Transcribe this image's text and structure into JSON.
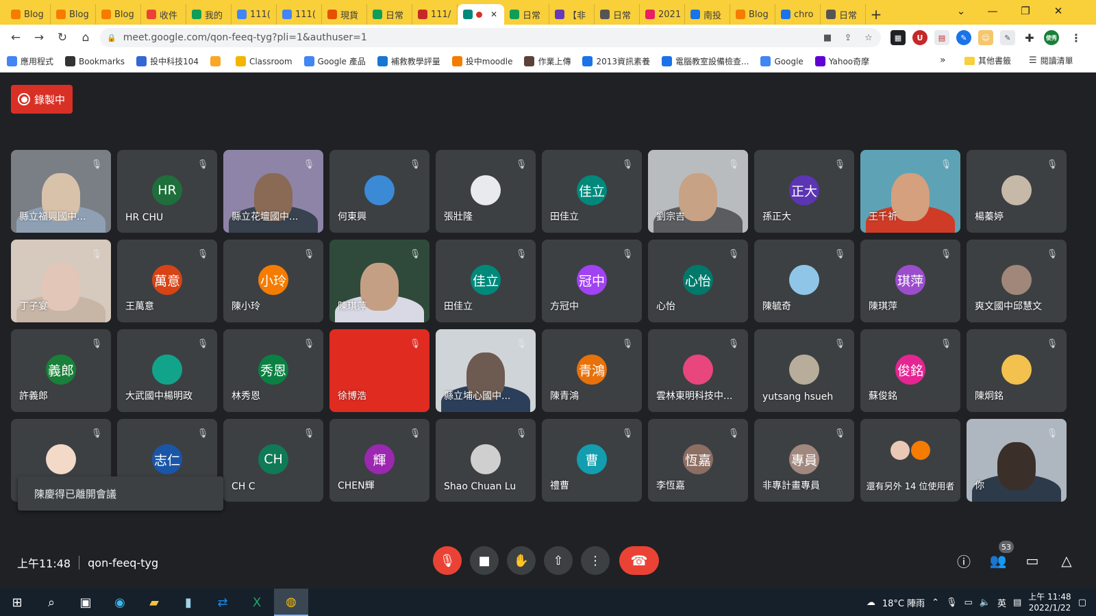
{
  "browser": {
    "tabs": [
      {
        "label": "Blog",
        "icon_color": "#f57c00"
      },
      {
        "label": "Blog",
        "icon_color": "#f57c00"
      },
      {
        "label": "Blog",
        "icon_color": "#f57c00"
      },
      {
        "label": "收件",
        "icon_color": "#ea4335"
      },
      {
        "label": "我的",
        "icon_color": "#0f9d58"
      },
      {
        "label": "111(",
        "icon_color": "#4285f4"
      },
      {
        "label": "111(",
        "icon_color": "#4285f4"
      },
      {
        "label": "現貨",
        "icon_color": "#e65100"
      },
      {
        "label": "日常",
        "icon_color": "#0f9d58"
      },
      {
        "label": "111/",
        "icon_color": "#c62828"
      },
      {
        "label": "",
        "icon_color": "#00897b",
        "active": true
      },
      {
        "label": "日常",
        "icon_color": "#0f9d58"
      },
      {
        "label": "【非",
        "icon_color": "#673ab7"
      },
      {
        "label": "日常",
        "icon_color": "#555555"
      },
      {
        "label": "2021",
        "icon_color": "#e91e63"
      },
      {
        "label": "南投",
        "icon_color": "#1a73e8"
      },
      {
        "label": "Blog",
        "icon_color": "#f57c00"
      },
      {
        "label": "chro",
        "icon_color": "#1a73e8"
      },
      {
        "label": "日常",
        "icon_color": "#555555"
      }
    ],
    "url": "meet.google.com/qon-feeq-tyg?pli=1&authuser=1",
    "bookmarks": [
      {
        "label": "應用程式",
        "color": "#4285f4"
      },
      {
        "label": "Bookmarks",
        "color": "#333333"
      },
      {
        "label": "投中科技104",
        "color": "#3367d6"
      },
      {
        "label": "",
        "color": "#f9a825"
      },
      {
        "label": "Classroom",
        "color": "#f4b400"
      },
      {
        "label": "Google 產品",
        "color": "#4285f4"
      },
      {
        "label": "補救教學評量",
        "color": "#1976d2"
      },
      {
        "label": "投中moodle",
        "color": "#f57c00"
      },
      {
        "label": "作業上傳",
        "color": "#5d4037"
      },
      {
        "label": "2013資訊素養",
        "color": "#1a73e8"
      },
      {
        "label": "電腦教室設備檢查...",
        "color": "#1a73e8"
      },
      {
        "label": "Google",
        "color": "#4285f4"
      },
      {
        "label": "Yahoo奇摩",
        "color": "#6001d2"
      }
    ],
    "bookmarks_more": "»",
    "other_bookmarks": "其他書籤",
    "reading_list": "閱讀清單",
    "profile_label": "使秀"
  },
  "meet": {
    "recording_label": "錄製中",
    "participants": [
      {
        "name": "縣立福興國中...",
        "type": "video",
        "bg": "#7a7f86",
        "head": "#d9c2aa",
        "body": "#8fa0b4"
      },
      {
        "name": "HR CHU",
        "initials": "HR",
        "color": "#1e6f3b"
      },
      {
        "name": "縣立花壇國中...",
        "type": "video",
        "bg": "#8e84a8",
        "head": "#8a6a55",
        "body": "#39424f"
      },
      {
        "name": "何東興",
        "initials": "",
        "color": "#3b8ad6"
      },
      {
        "name": "張壯隆",
        "initials": "",
        "color": "#e8eaed"
      },
      {
        "name": "田佳立",
        "initials": "佳立",
        "color": "#00897b"
      },
      {
        "name": "劉宗吉",
        "type": "video",
        "bg": "#b9bcbf",
        "head": "#c8a284",
        "body": "#5a5c60"
      },
      {
        "name": "孫正大",
        "initials": "正大",
        "color": "#5c35b3"
      },
      {
        "name": "王千祈",
        "type": "video",
        "bg": "#5ea3b5",
        "head": "#d4a07e",
        "body": "#cf3b26"
      },
      {
        "name": "楊蓁婷",
        "initials": "",
        "color": "#c6b9a8"
      },
      {
        "name": "丁子宴",
        "type": "video",
        "bg": "#d6c9bd",
        "head": "#e2c6b8",
        "body": "#c7b5a6"
      },
      {
        "name": "王萬意",
        "initials": "萬意",
        "color": "#d84315"
      },
      {
        "name": "陳小玲",
        "initials": "小玲",
        "color": "#f57c00"
      },
      {
        "name": "陳琪萍",
        "type": "video",
        "bg": "#2f4a3a",
        "head": "#c59f84",
        "body": "#d9d9e6"
      },
      {
        "name": "田佳立",
        "initials": "佳立",
        "color": "#00897b"
      },
      {
        "name": "方冠中",
        "initials": "冠中",
        "color": "#a142f4"
      },
      {
        "name": "心怡",
        "initials": "心怡",
        "color": "#00796b"
      },
      {
        "name": "陳毓奇",
        "initials": "",
        "color": "#8fc6e8"
      },
      {
        "name": "陳琪萍",
        "initials": "琪萍",
        "color": "#9c4dcc"
      },
      {
        "name": "爽文國中邱慧文",
        "initials": "",
        "color": "#a0877a"
      },
      {
        "name": "許義郎",
        "initials": "義郎",
        "color": "#188038"
      },
      {
        "name": "大武國中楊明政",
        "initials": "",
        "color": "#12a48a"
      },
      {
        "name": "林秀恩",
        "initials": "秀恩",
        "color": "#0b8043"
      },
      {
        "name": "徐博浩",
        "type": "solid",
        "bg": "#e02b20"
      },
      {
        "name": "縣立埔心國中...",
        "type": "video",
        "bg": "#cfd4d8",
        "head": "#6d5a50",
        "body": "#2c3f5a"
      },
      {
        "name": "陳青鴻",
        "initials": "青鴻",
        "color": "#e8710a"
      },
      {
        "name": "雲林東明科技中...",
        "initials": "",
        "color": "#e8467c"
      },
      {
        "name": "yutsang hsueh",
        "initials": "",
        "color": "#b8ad9a"
      },
      {
        "name": "蘇俊銘",
        "initials": "俊銘",
        "color": "#e52592"
      },
      {
        "name": "陳炯銘",
        "initials": "",
        "color": "#f2c14e"
      },
      {
        "name": "陳慶得",
        "initials": "",
        "color": "#f3d9c8"
      },
      {
        "name": "",
        "initials": "志仁",
        "color": "#1a56a8"
      },
      {
        "name": "CH C",
        "initials": "CH",
        "color": "#0f7a55"
      },
      {
        "name": "CHEN輝",
        "initials": "輝",
        "color": "#9c27b0"
      },
      {
        "name": "Shao Chuan Lu",
        "initials": "",
        "color": "#cfcfcf"
      },
      {
        "name": "禮曹",
        "initials": "曹",
        "color": "#129eaf"
      },
      {
        "name": "李恆嘉",
        "initials": "恆嘉",
        "color": "#8d6e63"
      },
      {
        "name": "非專計畫專員",
        "initials": "專員",
        "color": "#a1887f"
      },
      {
        "name": "還有另外 14 位使用者",
        "type": "more"
      },
      {
        "name": "你",
        "type": "video",
        "bg": "#aeb7c0",
        "head": "#3b2f2a",
        "body": "#2d3a4a"
      }
    ],
    "toast": "陳慶得已離開會議",
    "time": "上午11:48",
    "meeting_code": "qon-feeq-tyg",
    "people_count": "53"
  },
  "taskbar": {
    "weather": "18°C  陣雨",
    "ime": "英",
    "time": "上午 11:48",
    "date": "2022/1/22"
  }
}
